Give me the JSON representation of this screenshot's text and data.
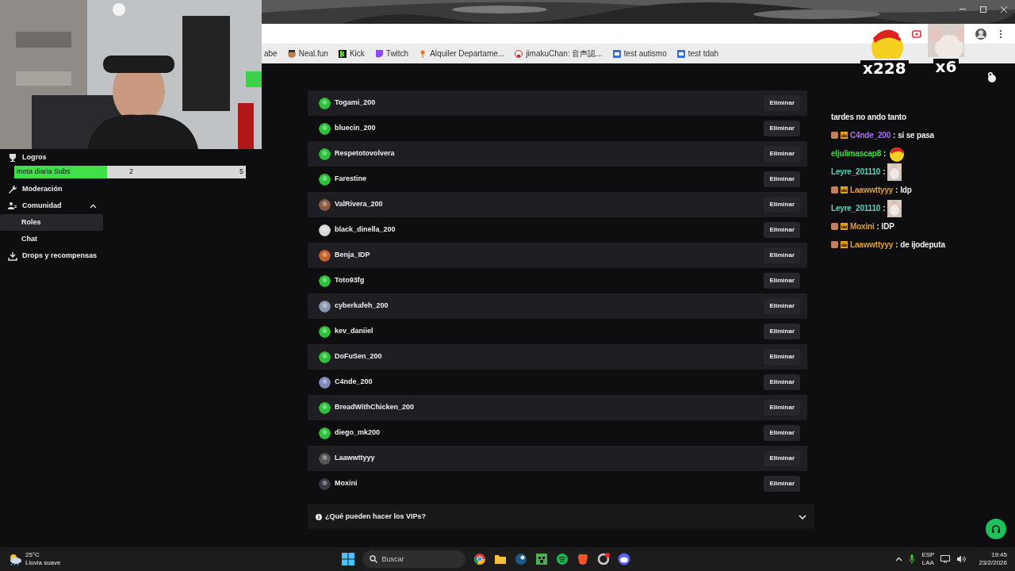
{
  "goal": {
    "label": "meta diaria Subs",
    "current": "2",
    "target": "5",
    "level": 0.4
  },
  "sidebar": {
    "items": [
      {
        "label": "Logros",
        "selected": false
      },
      {
        "label": "Moderación",
        "selected": false
      },
      {
        "label": "Comunidad",
        "selected": false,
        "expanded": true,
        "children": [
          {
            "label": "Roles",
            "selected": true
          },
          {
            "label": "Chat",
            "selected": false
          }
        ]
      },
      {
        "label": "Drops y recompensas",
        "selected": false
      }
    ]
  },
  "bookmarks": [
    {
      "label": "abe"
    },
    {
      "label": "Neal.fun"
    },
    {
      "label": "Kick"
    },
    {
      "label": "Twitch"
    },
    {
      "label": "Alquiler Departame..."
    },
    {
      "label": "jimakuChan: 音声認..."
    },
    {
      "label": "test autismo"
    },
    {
      "label": "test tdah"
    }
  ],
  "overlay_counters": [
    {
      "kind": "smiley",
      "count": "x228"
    },
    {
      "kind": "picture",
      "count": "x6"
    }
  ],
  "vips": [
    {
      "name": "Togami_200",
      "color": "#2fbf3a",
      "action": "Eliminar"
    },
    {
      "name": "bluecin_200",
      "color": "#2fbf3a",
      "action": "Eliminar"
    },
    {
      "name": "Respetotovolvera",
      "color": "#2fbf3a",
      "action": "Eliminar"
    },
    {
      "name": "Farestine",
      "color": "#2fbf3a",
      "action": "Eliminar"
    },
    {
      "name": "ValRivera_200",
      "color": "#8a5a44",
      "action": "Eliminar"
    },
    {
      "name": "black_dinella_200",
      "color": "#d8d8d8",
      "action": "Eliminar"
    },
    {
      "name": "Benja_IDP",
      "color": "#c0602a",
      "action": "Eliminar"
    },
    {
      "name": "Toto93fg",
      "color": "#2fbf3a",
      "action": "Eliminar"
    },
    {
      "name": "cyberkafeh_200",
      "color": "#8a97b0",
      "action": "Eliminar"
    },
    {
      "name": "kev_daniiel",
      "color": "#2fbf3a",
      "action": "Eliminar"
    },
    {
      "name": "DoFuSen_200",
      "color": "#2fbf3a",
      "action": "Eliminar"
    },
    {
      "name": "C4nde_200",
      "color": "#7f88b8",
      "action": "Eliminar"
    },
    {
      "name": "BreadWithChicken_200",
      "color": "#2fbf3a",
      "action": "Eliminar"
    },
    {
      "name": "diego_mk200",
      "color": "#2fbf3a",
      "action": "Eliminar"
    },
    {
      "name": "Laawwttyyy",
      "color": "#555555",
      "action": "Eliminar"
    },
    {
      "name": "Moxini",
      "color": "#3a3a44",
      "action": "Eliminar"
    }
  ],
  "faq": {
    "label": "¿Qué pueden hacer los VIPs?",
    "expanded": false
  },
  "chat": [
    {
      "kind": "continuation",
      "text": "tardes no ando tanto"
    },
    {
      "kind": "text",
      "badged": true,
      "user": "C4nde_200",
      "color": "#a970ff",
      "separator": ":",
      "text": "si se pasa"
    },
    {
      "kind": "smiley",
      "badged": false,
      "user": "eljulimascap8",
      "color": "#3ddc3d",
      "separator": ":"
    },
    {
      "kind": "picture",
      "badged": false,
      "user": "Leyre_201110",
      "color": "#5fd0b8",
      "separator": ":"
    },
    {
      "kind": "text",
      "badged": true,
      "user": "Laawwttyyy",
      "color": "#e0a030",
      "separator": ":",
      "text": "ldp"
    },
    {
      "kind": "picture",
      "badged": false,
      "user": "Leyre_201110",
      "color": "#5fd0b8",
      "separator": ":"
    },
    {
      "kind": "text",
      "badged": true,
      "user": "Moxini",
      "color": "#e0a030",
      "separator": ":",
      "text": "IDP"
    },
    {
      "kind": "text",
      "badged": true,
      "user": "Laawwttyyy",
      "color": "#e0a030",
      "separator": ":",
      "text": "de ijodeputa"
    }
  ],
  "taskbar": {
    "temperature": "25°C",
    "weather": "Lluvia suave",
    "search_placeholder": "Buscar",
    "language": "ESP",
    "layout": "LAA",
    "time": "19:45",
    "date": "23/2/2026"
  }
}
